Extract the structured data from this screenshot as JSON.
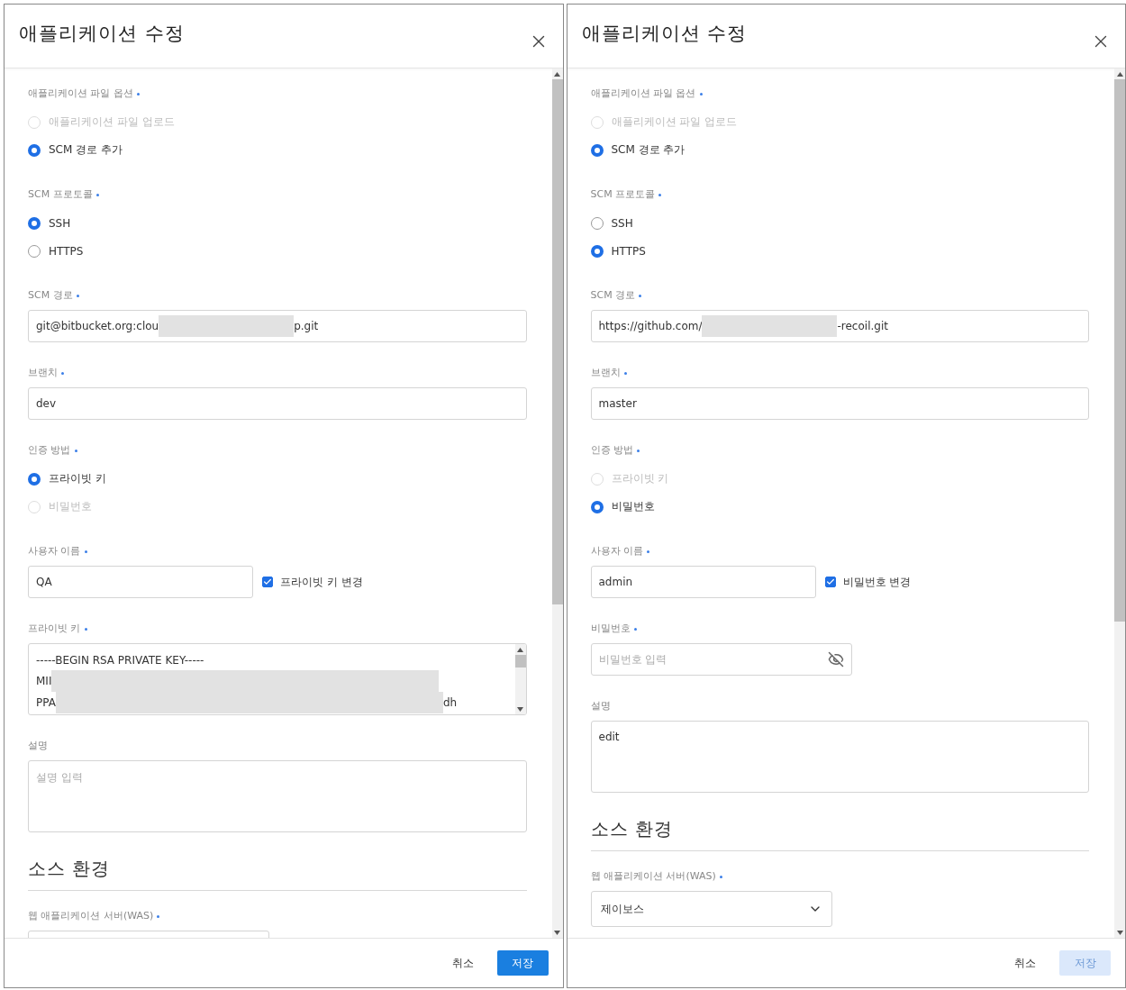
{
  "dialogs": [
    {
      "title": "애플리케이션 수정",
      "fields": [
        {
          "kind": "radio_group",
          "label": "애플리케이션 파일 옵션",
          "required": true,
          "options": [
            {
              "label": "애플리케이션 파일 업로드",
              "selected": false,
              "disabled": true
            },
            {
              "label": "SCM 경로 추가",
              "selected": true,
              "disabled": false
            }
          ]
        },
        {
          "kind": "radio_group",
          "label": "SCM 프로토콜",
          "required": true,
          "options": [
            {
              "label": "SSH",
              "selected": true,
              "disabled": false
            },
            {
              "label": "HTTPS",
              "selected": false,
              "disabled": false
            }
          ]
        },
        {
          "kind": "text",
          "label": "SCM 경로",
          "required": true,
          "parts": [
            "git@bitbucket.org:clou",
            "p.git"
          ],
          "redacted": true
        },
        {
          "kind": "text",
          "label": "브랜치",
          "required": true,
          "parts": [
            "dev"
          ]
        },
        {
          "kind": "radio_group",
          "label": "인증 방법",
          "required": true,
          "options": [
            {
              "label": "프라이빗 키",
              "selected": true,
              "disabled": false
            },
            {
              "label": "비밀번호",
              "selected": false,
              "disabled": true
            }
          ]
        },
        {
          "kind": "user_row",
          "label": "사용자 이름",
          "required": true,
          "value": "QA",
          "checkbox": {
            "label": "프라이빗 키 변경",
            "checked": true
          }
        },
        {
          "kind": "key_area",
          "label": "프라이빗 키",
          "required": true,
          "lines": [
            {
              "parts": [
                "-----BEGIN RSA PRIVATE KEY-----"
              ],
              "redacted": false
            },
            {
              "parts": [
                "MII"
              ],
              "redacted": true
            },
            {
              "parts": [
                "PPA",
                "dh"
              ],
              "redacted": true
            }
          ]
        },
        {
          "kind": "textarea",
          "label": "설명",
          "placeholder": "설명 입력"
        },
        {
          "kind": "heading",
          "text": "소스 환경"
        },
        {
          "kind": "select",
          "label": "웹 애플리케이션 서버(WAS)",
          "required": true
        }
      ],
      "footer": {
        "cancel": "취소",
        "save": "저장",
        "save_disabled": false
      }
    },
    {
      "title": "애플리케이션 수정",
      "fields": [
        {
          "kind": "radio_group",
          "label": "애플리케이션 파일 옵션",
          "required": true,
          "options": [
            {
              "label": "애플리케이션 파일 업로드",
              "selected": false,
              "disabled": true
            },
            {
              "label": "SCM 경로 추가",
              "selected": true,
              "disabled": false
            }
          ]
        },
        {
          "kind": "radio_group",
          "label": "SCM 프로토콜",
          "required": true,
          "options": [
            {
              "label": "SSH",
              "selected": false,
              "disabled": false
            },
            {
              "label": "HTTPS",
              "selected": true,
              "disabled": false
            }
          ]
        },
        {
          "kind": "text",
          "label": "SCM 경로",
          "required": true,
          "parts": [
            "https://github.com/",
            "-recoil.git"
          ],
          "redacted": true
        },
        {
          "kind": "text",
          "label": "브랜치",
          "required": true,
          "parts": [
            "master"
          ]
        },
        {
          "kind": "radio_group",
          "label": "인증 방법",
          "required": true,
          "options": [
            {
              "label": "프라이빗 키",
              "selected": false,
              "disabled": true
            },
            {
              "label": "비밀번호",
              "selected": true,
              "disabled": false
            }
          ]
        },
        {
          "kind": "user_row",
          "label": "사용자 이름",
          "required": true,
          "value": "admin",
          "checkbox": {
            "label": "비밀번호 변경",
            "checked": true
          }
        },
        {
          "kind": "password",
          "label": "비밀번호",
          "required": true,
          "placeholder": "비밀번호 입력"
        },
        {
          "kind": "textarea",
          "label": "설명",
          "value": "edit"
        },
        {
          "kind": "heading",
          "text": "소스 환경"
        },
        {
          "kind": "select",
          "label": "웹 애플리케이션 서버(WAS)",
          "required": true,
          "value": "제이보스"
        }
      ],
      "footer": {
        "cancel": "취소",
        "save": "저장",
        "save_disabled": true
      }
    }
  ]
}
